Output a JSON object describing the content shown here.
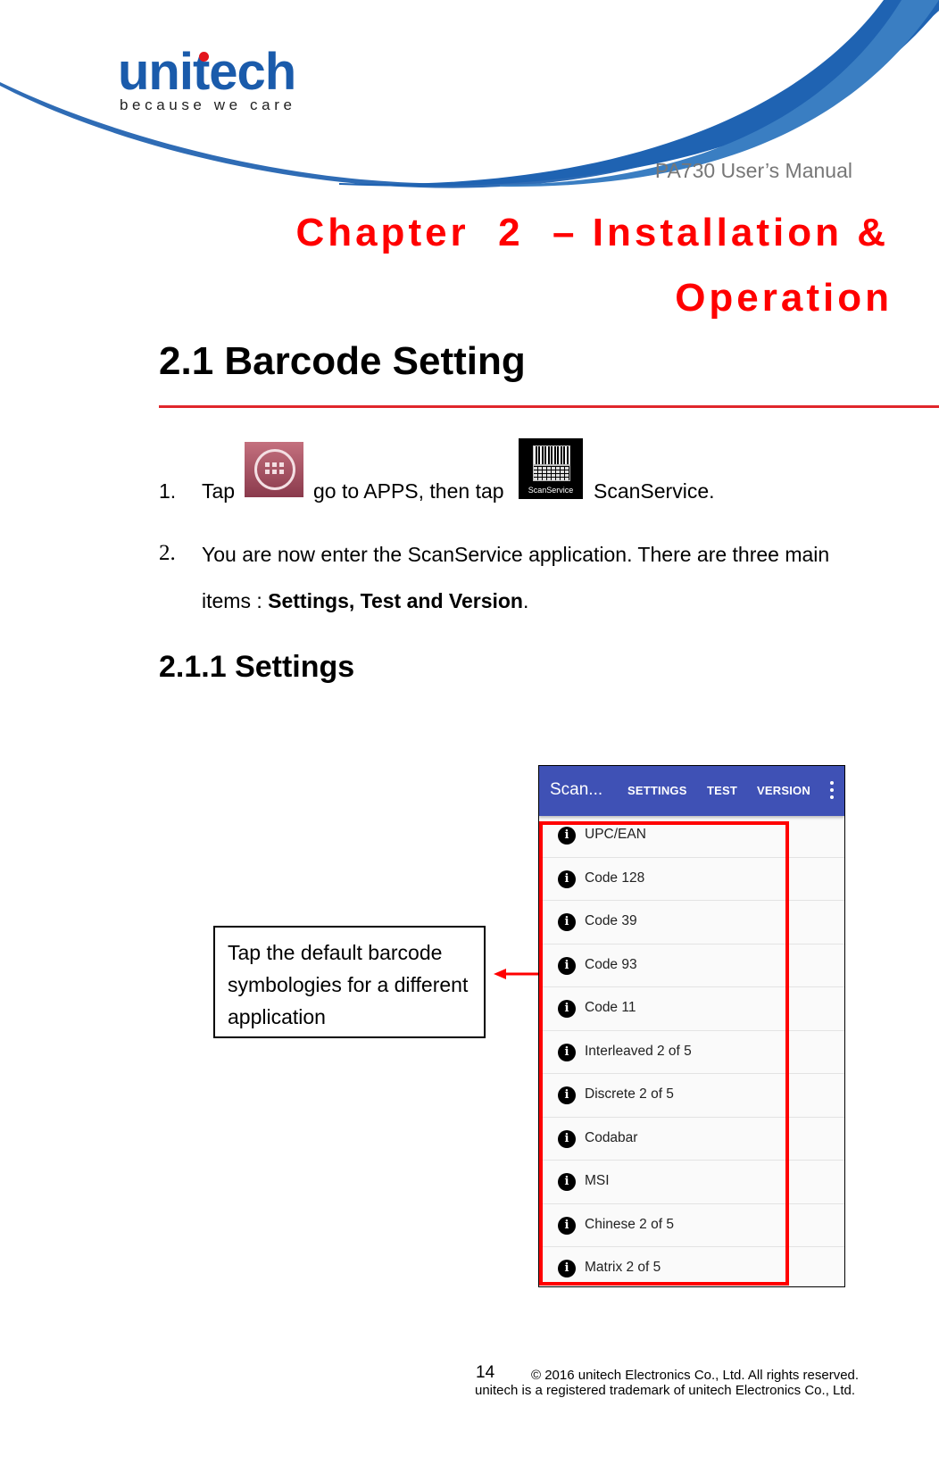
{
  "header": {
    "logo_text": "unitech",
    "logo_tagline": "because we care",
    "manual_title": "PA730 User’s Manual"
  },
  "chapter": {
    "line1": "Chapter  2  – Installation &",
    "line2": "Operation"
  },
  "section": {
    "title": "2.1 Barcode Setting"
  },
  "steps": [
    {
      "number": "1.",
      "text_before": "Tap",
      "icon1": "apps-launcher-icon",
      "text_middle": "go to APPS, then tap",
      "icon2": "scanservice-app-icon",
      "icon2_label": "ScanService",
      "text_after": "ScanService."
    },
    {
      "number": "2.",
      "line1": "You are now enter the ScanService application. There are three main",
      "line2_prefix": "items : ",
      "line2_bold": "Settings, Test and Version",
      "line2_suffix": "."
    }
  ],
  "subsection": {
    "title": "2.1.1 Settings"
  },
  "callout": {
    "text": "Tap the default barcode symbologies for a different application"
  },
  "phone": {
    "app_title": "Scan...",
    "tabs": [
      "SETTINGS",
      "TEST",
      "VERSION"
    ],
    "menu_icon": "overflow-menu-icon",
    "bar_color": "#3f51b5",
    "items": [
      "UPC/EAN",
      "Code 128",
      "Code 39",
      "Code 93",
      "Code 11",
      "Interleaved 2 of 5",
      "Discrete 2 of 5",
      "Codabar",
      "MSI",
      "Chinese 2 of 5",
      "Matrix 2 of 5"
    ],
    "item_icon": "info-icon",
    "highlight_color": "#ff0000"
  },
  "footer": {
    "page_number": "14",
    "copyright": "© 2016 unitech Electronics Co., Ltd. All rights reserved.",
    "trademark": "unitech is a registered trademark of unitech Electronics Co., Ltd."
  },
  "colors": {
    "chapter_red": "#ff0000",
    "brand_blue": "#1a5bab",
    "rule_red": "#e0262b"
  }
}
